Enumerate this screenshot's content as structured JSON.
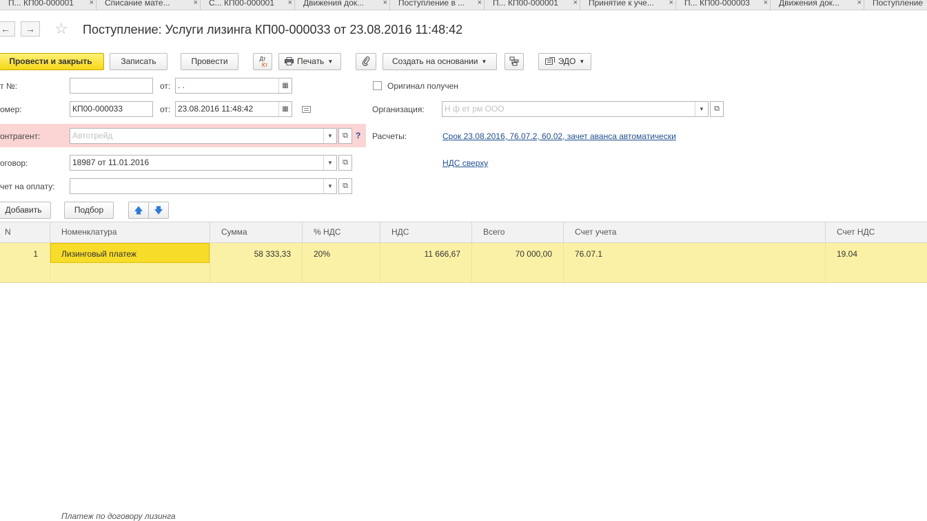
{
  "tabs": [
    {
      "label": "П... КП00-000001"
    },
    {
      "label": "Списание мате..."
    },
    {
      "label": "С... КП00-000001"
    },
    {
      "label": "Движения док..."
    },
    {
      "label": "Поступление в ..."
    },
    {
      "label": "П... КП00-000001"
    },
    {
      "label": "Принятие к уче..."
    },
    {
      "label": "П... КП00-000003"
    },
    {
      "label": "Движения док..."
    },
    {
      "label": "Поступление"
    }
  ],
  "tab_close_glyph": "×",
  "nav": {
    "back": "←",
    "forward": "→",
    "star": "☆"
  },
  "title": "Поступление: Услуги лизинга КП00-000033 от 23.08.2016 11:48:42",
  "toolbar": {
    "post_close": "Провести и закрыть",
    "save": "Записать",
    "post": "Провести",
    "dtkt_top": "Дт",
    "dtkt_bottom": "Кт",
    "print": "Печать",
    "create_based": "Создать на основании",
    "edo": "ЭДО"
  },
  "form": {
    "act_label": "т №:",
    "act_value": "",
    "act_date_label": "от:",
    "act_date_value": " .  .",
    "original_label": "Оригинал получен",
    "original_checked": false,
    "number_label": "омер:",
    "number_value": "КП00-000033",
    "date_label": "от:",
    "date_value": "23.08.2016 11:48:42",
    "org_label": "Организация:",
    "org_value": "Н    ф  ет   рм ООО",
    "contractor_label": "онтрагент:",
    "contractor_value": "Автотрейд",
    "help": "?",
    "payments_label": "Расчеты:",
    "payments_link": "Срок 23.08.2016, 76.07.2, 60.02, зачет аванса автоматически",
    "contract_label": "оговор:",
    "contract_value": "18987 от 11.01.2016",
    "vat_link": "НДС сверху",
    "invoice_label": "чет на оплату:",
    "invoice_value": ""
  },
  "table_toolbar": {
    "add": "Добавить",
    "select": "Подбор",
    "up": "🡅",
    "down": "🡇"
  },
  "table": {
    "columns": [
      "N",
      "Номенклатура",
      "Сумма",
      "% НДС",
      "НДС",
      "Всего",
      "Счет учета",
      "Счет НДС"
    ],
    "rows": [
      {
        "n": "1",
        "item": "Лизинговый платеж",
        "content": "Платеж по договору лизинга",
        "sum": "58 333,33",
        "vat_rate": "20%",
        "vat": "11 666,67",
        "total": "70 000,00",
        "account": "76.07.1",
        "vat_account": "19.04"
      }
    ]
  },
  "colors": {
    "primary_button": "#f5d81b",
    "selected_row": "#fbf1a6",
    "selected_cell": "#f7dc2a",
    "error_band": "#fbd4d4",
    "link": "#1f4f8f"
  }
}
